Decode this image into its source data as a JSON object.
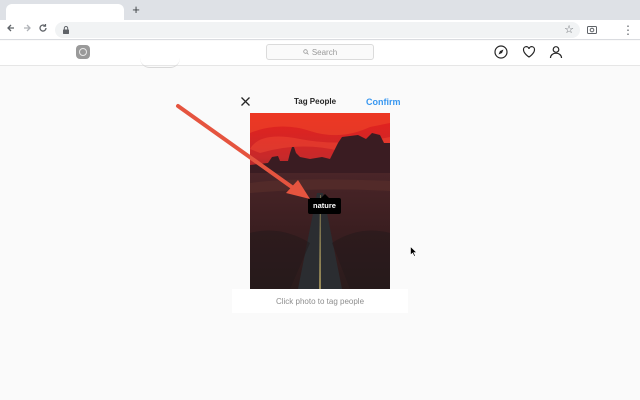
{
  "browser": {
    "new_tab_label": "+",
    "back_icon": "arrow-left-icon",
    "forward_icon": "arrow-right-icon",
    "reload_icon": "reload-icon",
    "lock_icon": "lock-icon",
    "bookmark_icon": "star-icon",
    "extension_icon": "extension-icon",
    "menu_icon": "more-vert-icon"
  },
  "header": {
    "logo_icon": "instagram-icon",
    "search_placeholder": "Search",
    "icons": [
      "compass-icon",
      "heart-icon",
      "profile-icon"
    ]
  },
  "modal": {
    "title": "Tag People",
    "confirm_label": "Confirm",
    "close_icon": "close-icon",
    "tag_text": "nature",
    "hint": "Click photo to tag people"
  },
  "colors": {
    "accent": "#3897f0",
    "arrow": "#e5543f",
    "sky_top": "#e8201c",
    "background": "#fafafa"
  }
}
